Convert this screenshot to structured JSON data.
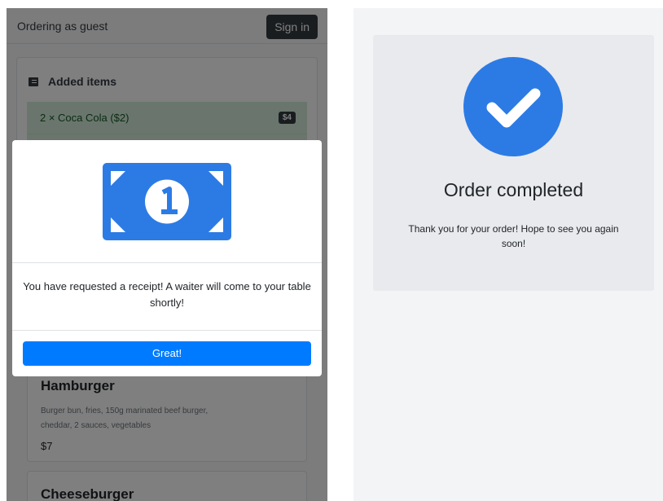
{
  "left_screen": {
    "navbar": {
      "guest_text": "Ordering as guest",
      "signin_label": "Sign in"
    },
    "added_items": {
      "header": "Added items",
      "items": [
        {
          "text": "2 × Coca Cola ($2)",
          "badge": "$4"
        }
      ]
    },
    "menu": [
      {
        "title": "Hamburger",
        "description": "Burger bun, fries, 150g marinated beef burger, cheddar, 2 sauces, vegetables",
        "price": "$7"
      },
      {
        "title": "Cheeseburger"
      }
    ],
    "modal": {
      "icon": "money-bill-icon",
      "message": "You have requested a receipt! A waiter will come to your table shortly!",
      "button_label": "Great!"
    }
  },
  "right_screen": {
    "icon": "check-circle-icon",
    "title": "Order completed",
    "message": "Thank you for your order! Hope to see you again soon!"
  },
  "colors": {
    "primary": "#007bff",
    "icon_blue": "#2c7be5",
    "dark": "#343a40",
    "success_bg": "#d4edda"
  }
}
